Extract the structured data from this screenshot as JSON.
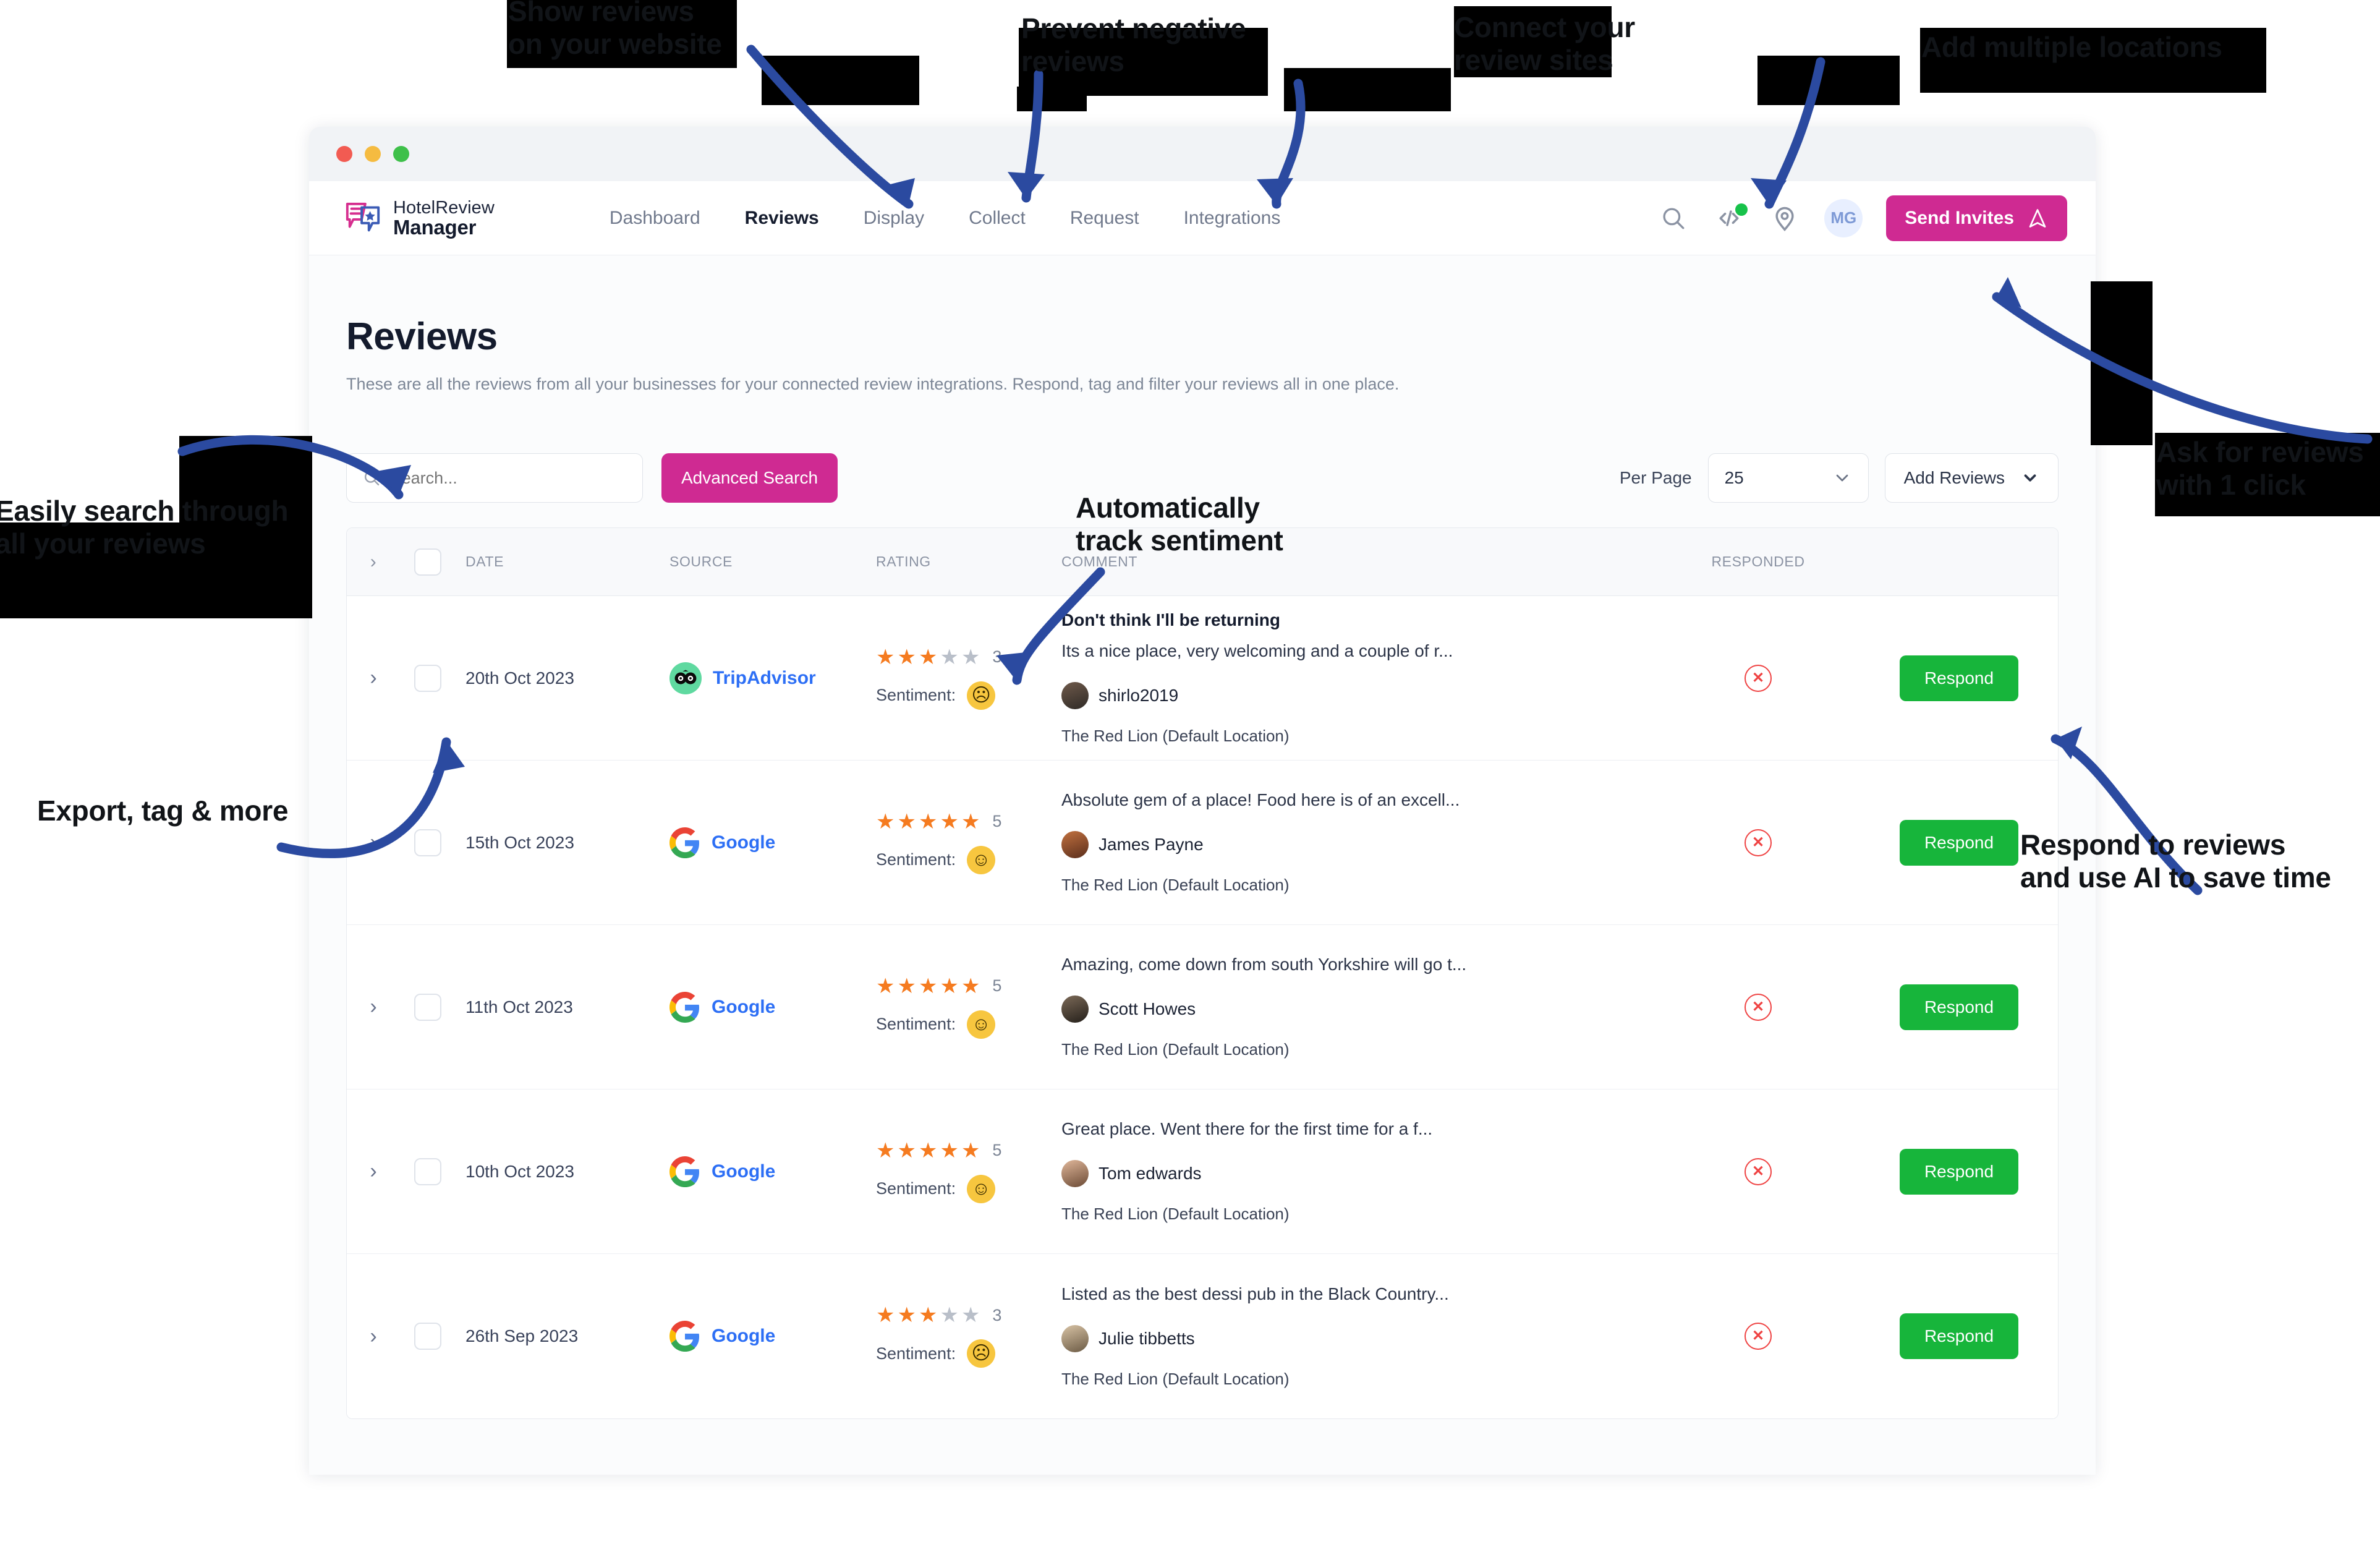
{
  "browser": {
    "dots": [
      "close",
      "minimize",
      "maximize"
    ]
  },
  "nav": {
    "brand_top": "HotelReview",
    "brand_bottom": "Manager",
    "links": [
      {
        "label": "Dashboard",
        "active": false
      },
      {
        "label": "Reviews",
        "active": true
      },
      {
        "label": "Display",
        "active": false
      },
      {
        "label": "Collect",
        "active": false
      },
      {
        "label": "Request",
        "active": false
      },
      {
        "label": "Integrations",
        "active": false
      }
    ],
    "icons": [
      "search-icon",
      "code-icon",
      "location-pin-icon"
    ],
    "avatar_initials": "MG",
    "send_invites_label": "Send Invites",
    "accent_color": "#cf2a92",
    "status_dot_color": "#17c24a"
  },
  "page": {
    "title": "Reviews",
    "subtitle": "These are all the reviews from all your businesses for your connected review integrations. Respond, tag and filter your reviews all in one place."
  },
  "toolbar": {
    "search_placeholder": "Search...",
    "search_value": "",
    "advanced_search_label": "Advanced Search",
    "per_page_label": "Per Page",
    "per_page_value": "25",
    "add_reviews_label": "Add Reviews"
  },
  "table": {
    "headers": [
      "DATE",
      "SOURCE",
      "RATING",
      "COMMENT",
      "RESPONDED"
    ],
    "respond_label": "Respond",
    "sentiment_label": "Sentiment:",
    "rows": [
      {
        "date": "20th Oct 2023",
        "source": "TripAdvisor",
        "rating": 3,
        "rating_max": 5,
        "sentiment": "negative",
        "comment_title": "Don't think I'll be returning",
        "comment_body": "Its a nice place, very welcoming and a couple of r...",
        "author": "shirlo2019",
        "location": "The Red Lion (Default Location)",
        "responded": false
      },
      {
        "date": "15th Oct 2023",
        "source": "Google",
        "rating": 5,
        "rating_max": 5,
        "sentiment": "positive",
        "comment_title": "",
        "comment_body": "Absolute gem of a place! Food here is of an excell...",
        "author": "James Payne",
        "location": "The Red Lion (Default Location)",
        "responded": false
      },
      {
        "date": "11th Oct 2023",
        "source": "Google",
        "rating": 5,
        "rating_max": 5,
        "sentiment": "positive",
        "comment_title": "",
        "comment_body": "Amazing, come down from south Yorkshire will go t...",
        "author": "Scott Howes",
        "location": "The Red Lion (Default Location)",
        "responded": false
      },
      {
        "date": "10th Oct 2023",
        "source": "Google",
        "rating": 5,
        "rating_max": 5,
        "sentiment": "positive",
        "comment_title": "",
        "comment_body": "Great place. Went there for the first time for a f...",
        "author": "Tom edwards",
        "location": "The Red Lion (Default Location)",
        "responded": false
      },
      {
        "date": "26th Sep 2023",
        "source": "Google",
        "rating": 3,
        "rating_max": 5,
        "sentiment": "negative",
        "comment_title": "",
        "comment_body": "Listed as the best dessi pub in the Black Country...",
        "author": "Julie tibbetts",
        "location": "The Red Lion (Default Location)",
        "responded": false
      }
    ]
  },
  "annotations": [
    {
      "id": "show-reviews",
      "text": "Show reviews\non your website"
    },
    {
      "id": "prevent-negative",
      "text": "Prevent negative\nreviews"
    },
    {
      "id": "connect-sites",
      "text": "Connect your\nreview sites"
    },
    {
      "id": "add-locations",
      "text": "Add multiple locations"
    },
    {
      "id": "easily-search",
      "text": "Easily search through\nall your reviews"
    },
    {
      "id": "track-sentiment",
      "text": "Automatically\ntrack sentiment"
    },
    {
      "id": "export-tag",
      "text": "Export, tag & more"
    },
    {
      "id": "ask-for-reviews",
      "text": "Ask for reviews\nwith 1 click"
    },
    {
      "id": "respond-reviews",
      "text": "Respond to reviews\nand use AI to save time"
    }
  ]
}
